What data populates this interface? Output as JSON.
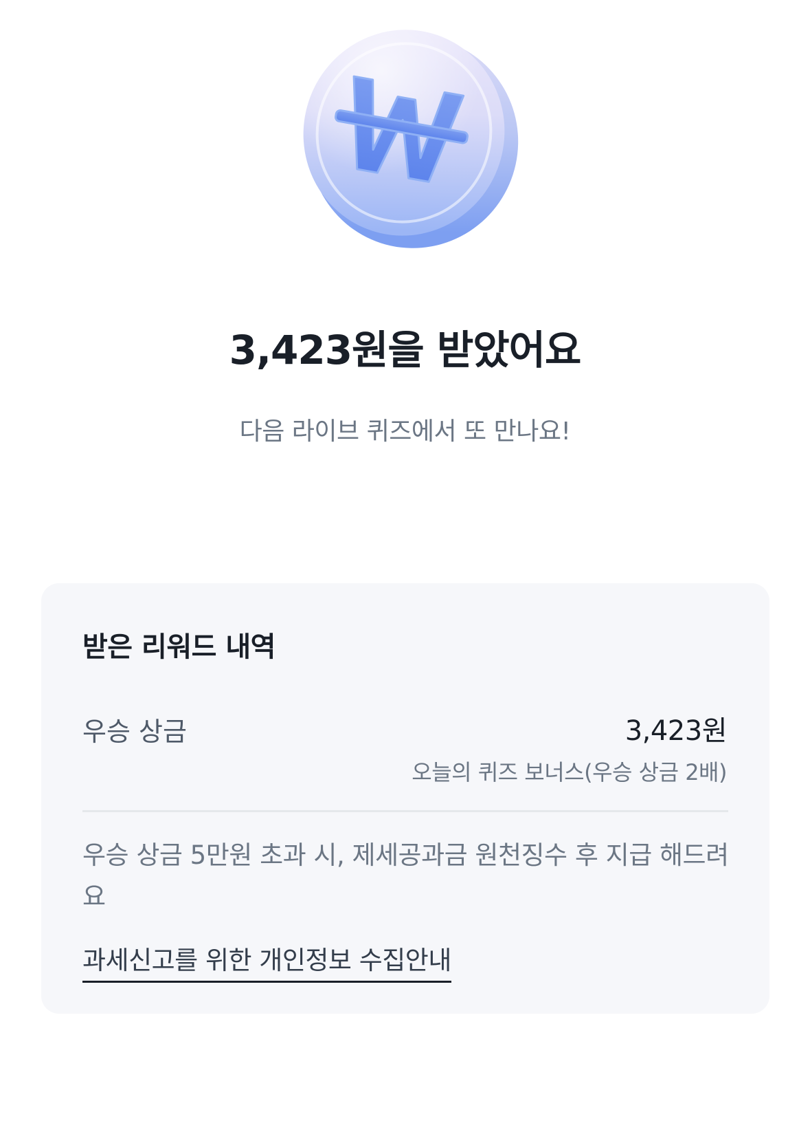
{
  "hero": {
    "icon": "won-coin-icon",
    "title": "3,423원을 받았어요",
    "subtitle": "다음 라이브 퀴즈에서 또 만나요!"
  },
  "reward_card": {
    "title": "받은 리워드 내역",
    "row": {
      "label": "우승 상금",
      "amount": "3,423원",
      "detail": "오늘의 퀴즈 보너스(우승 상금 2배)"
    },
    "notice": "우승 상금 5만원 초과 시, 제세공과금 원천징수 후 지급 해드려요",
    "privacy_link": "과세신고를 위한 개인정보 수집안내"
  },
  "colors": {
    "background": "#ffffff",
    "card_background": "#f6f7fa",
    "coin_primary": "#6c95f2",
    "coin_light": "#ddd8f8"
  }
}
